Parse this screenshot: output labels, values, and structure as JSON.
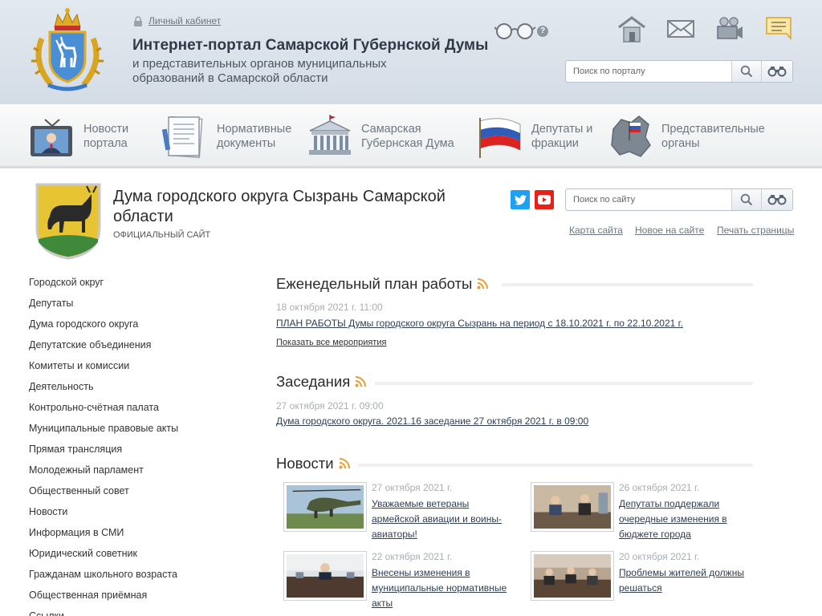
{
  "portal": {
    "cabinet_link": "Личный кабинет",
    "title": "Интернет-портал Самарской Губернской Думы",
    "subtitle": "и представительных органов муниципальных образований в Самарской области",
    "help_mark": "?",
    "search_placeholder": "Поиск по порталу"
  },
  "nav": [
    {
      "label": "Новости портала"
    },
    {
      "label": "Нормативные документы"
    },
    {
      "label": "Самарская Губернская Дума"
    },
    {
      "label": "Депутаты и фракции"
    },
    {
      "label": "Представительные органы"
    }
  ],
  "site": {
    "title": "Дума городского округа Сызрань Самарской области",
    "subtitle": "ОФИЦИАЛЬНЫЙ САЙТ",
    "search_placeholder": "Поиск по сайту",
    "links": [
      "Карта сайта",
      "Новое на сайте",
      "Печать страницы"
    ]
  },
  "menu": [
    "Городской округ",
    "Депутаты",
    "Дума городского округа",
    "Депутатские объединения",
    "Комитеты и комиссии",
    "Деятельность",
    "Контрольно-счётная палата",
    "Муниципальные правовые акты",
    "Прямая трансляция",
    "Молодежный парламент",
    "Общественный совет",
    "Новости",
    "Информация в СМИ",
    "Юридический советник",
    "Гражданам школьного возраста",
    "Общественная приёмная",
    "Ссылки"
  ],
  "weekly": {
    "heading": "Еженедельный план работы",
    "date": "18 октября 2021 г.   11:00",
    "link": "ПЛАН РАБОТЫ Думы городского округа Сызрань на период с 18.10.2021 г. по 22.10.2021 г.",
    "show_all": "Показать все мероприятия"
  },
  "sessions": {
    "heading": "Заседания",
    "date": "27 октября 2021 г. 09:00",
    "link": "Дума городского округа. 2021.16 заседание 27 октября 2021 г. в 09:00"
  },
  "news": {
    "heading": "Новости",
    "items": [
      {
        "date": "27 октября 2021 г.",
        "title": "Уважаемые ветераны армейской авиации и воины-авиаторы!"
      },
      {
        "date": "26 октября 2021 г.",
        "title": "Депутаты поддержали очередные изменения в бюджете города"
      },
      {
        "date": "22 октября 2021 г.",
        "title": "Внесены изменения в муниципальные нормативные акты"
      },
      {
        "date": "20 октября 2021 г.",
        "title": "Проблемы жителей должны решаться"
      }
    ]
  },
  "colors": {
    "header_bg": "#dbe2ea",
    "rss": "#f39a2b",
    "twitter": "#1da1f2",
    "youtube": "#e62117",
    "link": "#2d3e53"
  }
}
